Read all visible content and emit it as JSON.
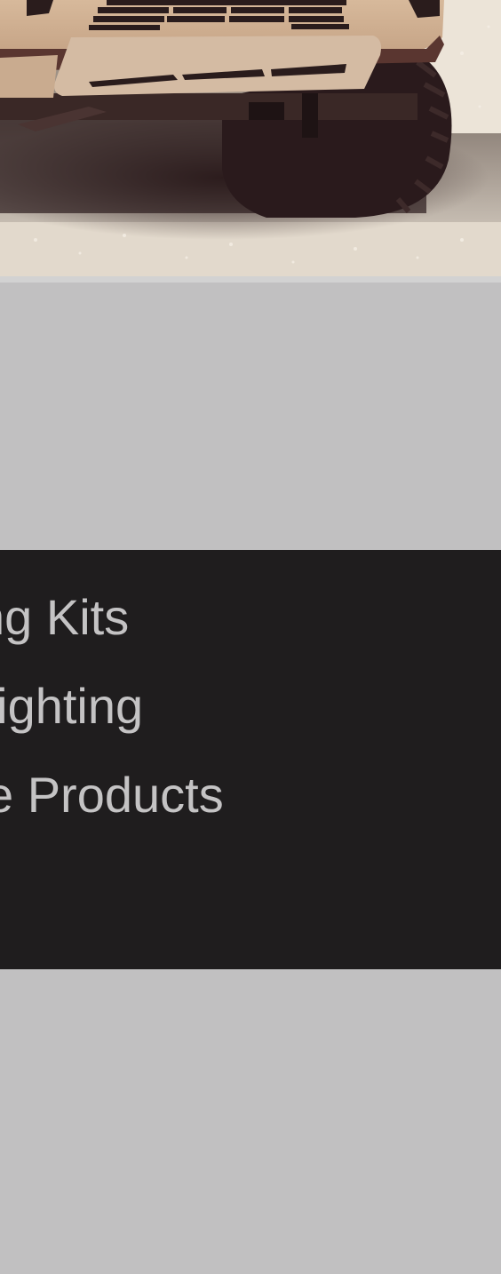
{
  "colors": {
    "background": "#c1c0c1",
    "nav_panel": "#1f1d1e",
    "nav_text": "#c4c3c4",
    "divider": "#d2d2d2"
  },
  "hero": {
    "image_icon": "truck-front-photo"
  },
  "nav": {
    "items": [
      {
        "label": "ng Kits"
      },
      {
        "label": " Lighting"
      },
      {
        "label": "ce Products"
      }
    ]
  }
}
